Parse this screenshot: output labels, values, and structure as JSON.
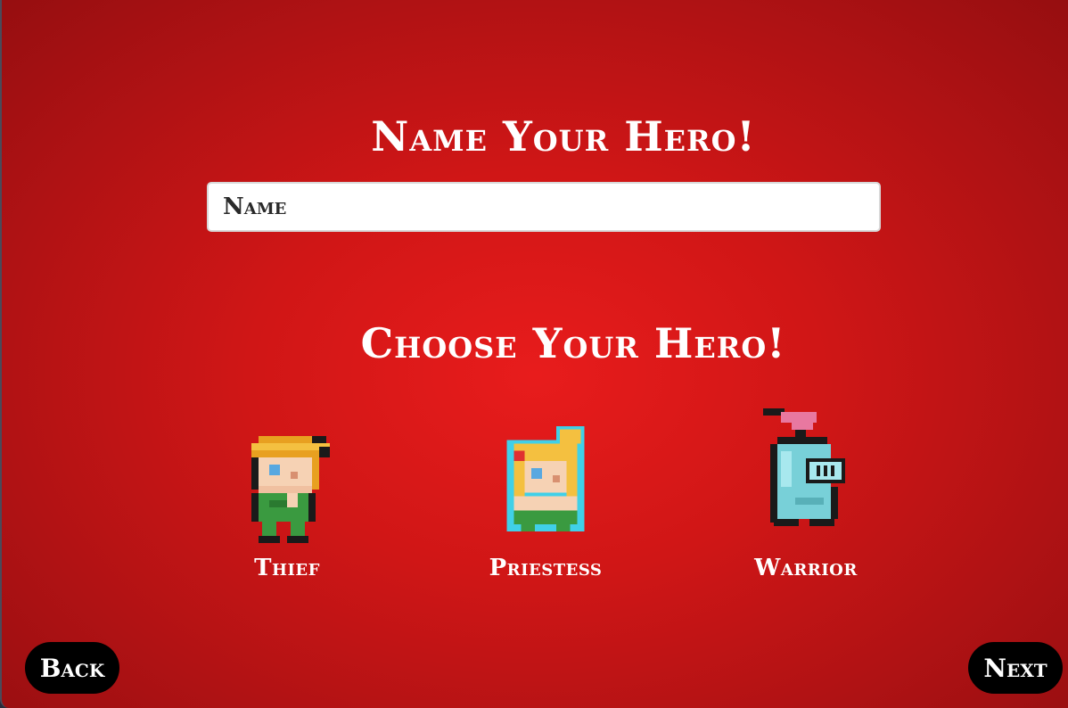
{
  "name_section": {
    "title": "Name Your Hero!",
    "input_placeholder": "Name",
    "input_value": ""
  },
  "choose_section": {
    "title": "Choose Your Hero!",
    "heroes": [
      {
        "label": "Thief",
        "icon": "thief-sprite-icon"
      },
      {
        "label": "Priestess",
        "icon": "priestess-sprite-icon"
      },
      {
        "label": "Warrior",
        "icon": "warrior-sprite-icon"
      }
    ]
  },
  "navigation": {
    "back_label": "Back",
    "next_label": "Next"
  },
  "colors": {
    "background_center": "#e81c1c",
    "background_edge": "#960e10",
    "button_background": "#000000",
    "text": "#ffffff"
  }
}
